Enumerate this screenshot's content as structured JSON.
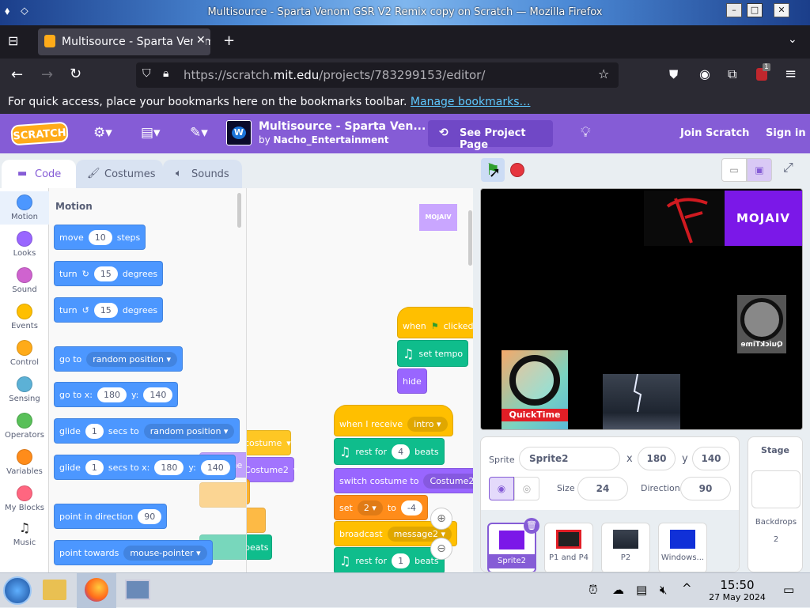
{
  "window": {
    "title": "Multisource - Sparta Venom GSR V2 Remix copy on Scratch — Mozilla Firefox",
    "btn_min": "–",
    "btn_max": "□",
    "btn_close": "✕"
  },
  "browser": {
    "tab_title": "Multisource - Sparta Venom GSR V2 Remix copy on Scratch",
    "url_prefix": "https://scratch.",
    "url_domain": "mit.edu",
    "url_path": "/projects/783299153/editor/",
    "bookmarks_msg": "For quick access, place your bookmarks here on the bookmarks toolbar.",
    "bookmarks_link": "Manage bookmarks…",
    "extension_badge": "1"
  },
  "scratch": {
    "logo": "SCRATCH",
    "project_title": "Multisource - Sparta Ven...",
    "project_by": "by",
    "author": "Nacho_Entertainment",
    "see_project": "See Project Page",
    "join": "Join Scratch",
    "signin": "Sign in",
    "tabs": {
      "code": "Code",
      "costumes": "Costumes",
      "sounds": "Sounds"
    },
    "categories": [
      {
        "label": "Motion",
        "color": "#4c97ff"
      },
      {
        "label": "Looks",
        "color": "#9966ff"
      },
      {
        "label": "Sound",
        "color": "#cf63cf"
      },
      {
        "label": "Events",
        "color": "#ffbf00"
      },
      {
        "label": "Control",
        "color": "#ffab19"
      },
      {
        "label": "Sensing",
        "color": "#5cb1d6"
      },
      {
        "label": "Operators",
        "color": "#59c059"
      },
      {
        "label": "Variables",
        "color": "#ff8c1a"
      },
      {
        "label": "My Blocks",
        "color": "#ff6680"
      },
      {
        "label": "Music",
        "color": "#0fbd8c"
      }
    ],
    "palette": {
      "heading": "Motion",
      "move": {
        "a": "move",
        "v": "10",
        "b": "steps"
      },
      "turn_right": {
        "a": "turn",
        "v": "15",
        "b": "degrees"
      },
      "turn_left": {
        "a": "turn",
        "v": "15",
        "b": "degrees"
      },
      "goto": {
        "a": "go to",
        "dd": "random position"
      },
      "gotoxy": {
        "a": "go to x:",
        "x": "180",
        "b": "y:",
        "y": "140"
      },
      "glide": {
        "a": "glide",
        "v": "1",
        "b": "secs to",
        "dd": "random position"
      },
      "glidexy": {
        "a": "glide",
        "v": "1",
        "b": "secs to x:",
        "x": "180",
        "c": "y:",
        "y": "140"
      },
      "point_dir": {
        "a": "point in direction",
        "v": "90"
      },
      "point_towards": {
        "a": "point towards",
        "dd": "mouse-pointer"
      },
      "ghost_1": "costume",
      "ghost_2": "Costume2",
      "ghost_3": "beats"
    },
    "workspace": {
      "sprite_thumb": "MOJAIV",
      "when_flag": {
        "a": "when",
        "b": "clicked"
      },
      "set_tempo": "set tempo",
      "hide": "hide",
      "when_receive": {
        "a": "when I receive",
        "dd": "intro"
      },
      "rest1": {
        "a": "rest for",
        "v": "4",
        "b": "beats"
      },
      "switch_costume": {
        "a": "switch costume to",
        "dd": "Costume2"
      },
      "set": {
        "a": "set",
        "dd": "2",
        "b": "to",
        "v": "-4"
      },
      "broadcast": {
        "a": "broadcast",
        "dd": "message2"
      },
      "rest2": {
        "a": "rest for",
        "v": "1",
        "b": "beats"
      }
    },
    "stage": {
      "viacom": "MOJAIV",
      "quicktime": "QuickTime",
      "quicktime_mirror": "QuickTime"
    },
    "sprite_info": {
      "sprite_label": "Sprite",
      "sprite_name": "Sprite2",
      "x_label": "x",
      "x": "180",
      "y_label": "y",
      "y": "140",
      "show_label": "Show",
      "size_label": "Size",
      "size": "24",
      "direction_label": "Direction",
      "direction": "90"
    },
    "sprites": [
      {
        "name": "Sprite2",
        "selected": true
      },
      {
        "name": "P1 and P4",
        "selected": false
      },
      {
        "name": "P2",
        "selected": false
      },
      {
        "name": "Windows...",
        "selected": false
      }
    ],
    "stage_panel": {
      "title": "Stage",
      "backdrops_label": "Backdrops",
      "backdrops_count": "2"
    }
  },
  "taskbar": {
    "time": "15:50",
    "date": "27 May 2024"
  }
}
